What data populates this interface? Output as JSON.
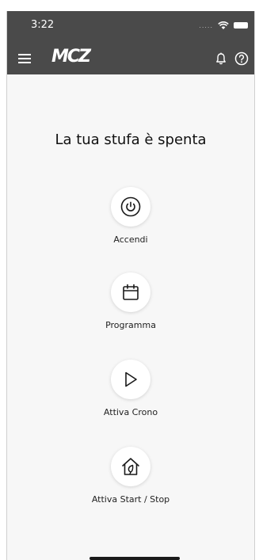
{
  "status_bar": {
    "time": "3:22",
    "signal": "....."
  },
  "app_bar": {
    "logo_text": "MCZ",
    "menu_icon": "hamburger-menu-icon",
    "bell_icon": "bell-icon",
    "help_icon": "help-circle-icon"
  },
  "main": {
    "status_message": "La tua stufa è spenta",
    "actions": [
      {
        "label": "Accendi",
        "icon": "power-icon"
      },
      {
        "label": "Programma",
        "icon": "calendar-icon"
      },
      {
        "label": "Attiva Crono",
        "icon": "play-icon"
      },
      {
        "label": "Attiva Start / Stop",
        "icon": "house-leaf-icon"
      }
    ]
  },
  "colors": {
    "header_bg": "#4a4a4a",
    "page_bg": "#f7f7f7",
    "text": "#111111"
  }
}
